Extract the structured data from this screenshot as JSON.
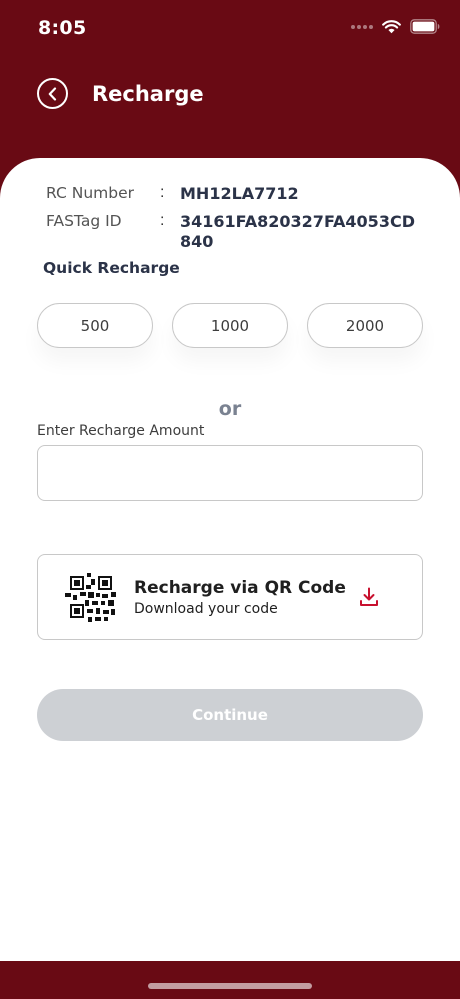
{
  "status_bar": {
    "time": "8:05"
  },
  "header": {
    "title": "Recharge"
  },
  "vehicle_info": {
    "rc_label": "RC Number",
    "rc_value": "MH12LA7712",
    "fastag_label": "FASTag ID",
    "fastag_value": "34161FA820327FA4053CD840",
    "separator": ":"
  },
  "quick_recharge": {
    "title": "Quick Recharge",
    "amounts": [
      "500",
      "1000",
      "2000"
    ]
  },
  "or_divider": "or",
  "amount_field": {
    "label": "Enter Recharge Amount",
    "value": "",
    "placeholder": ""
  },
  "qr_card": {
    "title": "Recharge via QR Code",
    "subtitle": "Download your code",
    "icon": "download-icon"
  },
  "continue_button": {
    "label": "Continue"
  },
  "colors": {
    "brand": "#690a14",
    "accent": "#c8102e",
    "disabled_button": "#cdd0d4",
    "text_dark": "#2b3348"
  }
}
